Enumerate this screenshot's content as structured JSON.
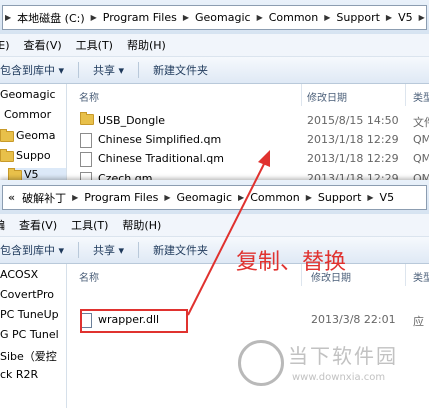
{
  "window_top": {
    "address": [
      "本地磁盘 (C:)",
      "Program Files",
      "Geomagic",
      "Common",
      "Support",
      "V5"
    ],
    "menu": [
      "(E)",
      "查看(V)",
      "工具(T)",
      "帮助(H)"
    ],
    "toolbar": [
      "包含到库中 ▾",
      "共享 ▾",
      "新建文件夹"
    ],
    "nav": [
      "Geomagic",
      "Commor",
      "Geoma",
      "Suppo",
      "V5"
    ],
    "headers": {
      "name": "名称",
      "date": "修改日期",
      "type": "类型"
    },
    "files": [
      {
        "name": "USB_Dongle",
        "date": "2015/8/15 14:50",
        "type": "文件",
        "icon": "folder-icon"
      },
      {
        "name": "Chinese Simplified.qm",
        "date": "2013/1/18 12:29",
        "type": "QM",
        "icon": "file-icon"
      },
      {
        "name": "Chinese Traditional.qm",
        "date": "2013/1/18 12:29",
        "type": "QM",
        "icon": "file-icon"
      },
      {
        "name": "Czech.qm",
        "date": "2013/1/18 12:29",
        "type": "QM",
        "icon": "file-icon"
      }
    ]
  },
  "window_bottom": {
    "address": [
      "破解补丁",
      "Program Files",
      "Geomagic",
      "Common",
      "Support",
      "V5"
    ],
    "menu": [
      "编",
      "查看(V)",
      "工具(T)",
      "帮助(H)"
    ],
    "toolbar": [
      "包含到库中 ▾",
      "共享 ▾",
      "新建文件夹"
    ],
    "nav": [
      "ACOSX",
      "CovertPro",
      "PC TuneUp",
      "G PC Tunel",
      "Sibe（爱控",
      "ck R2R"
    ],
    "headers": {
      "name": "名称",
      "date": "修改日期",
      "type": "类型"
    },
    "files": [
      {
        "name": "wrapper.dll",
        "date": "2013/3/8 22:01",
        "type": "应",
        "icon": "dll-file-icon"
      }
    ]
  },
  "annotation": "复制、替换",
  "watermark": {
    "title": "当下软件园",
    "url": "www.downxia.com"
  },
  "colors": {
    "accent_red": "#e0322f"
  }
}
